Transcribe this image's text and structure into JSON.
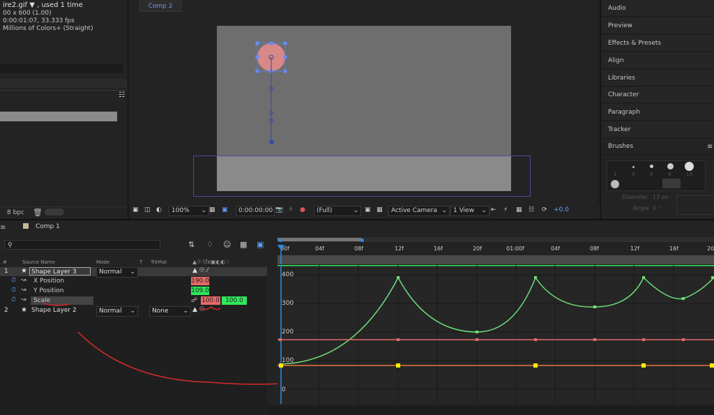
{
  "project": {
    "file_title": "ire2.gif",
    "file_used": ", used 1 time",
    "file_dims": "00 x 600 (1.00)",
    "file_duration": "0:00:01:07, 33.333 fps",
    "file_colors": "Millions of Colors+ (Straight)",
    "bpc": "8 bpc"
  },
  "comp_viewer": {
    "tab_label": "Comp 2",
    "zoom": "100%",
    "timecode": "0:00:00:00",
    "resolution": "(Full)",
    "camera": "Active Camera",
    "views": "1 View",
    "exposure": "+0.0"
  },
  "right_panel": {
    "items": [
      "Audio",
      "Preview",
      "Effects & Presets",
      "Align",
      "Libraries",
      "Character",
      "Paragraph",
      "Tracker",
      "Brushes"
    ],
    "brush_sizes": [
      "1",
      "3",
      "5",
      "9",
      "13"
    ],
    "diameter_label": "Diameter",
    "diameter_value": "13 px",
    "angle_label": "Angle",
    "angle_value": "0 °"
  },
  "timeline": {
    "tab_label": "Comp 1",
    "search_placeholder": "",
    "columns": {
      "num": "#",
      "source": "Source Name",
      "mode": "Mode",
      "t": "T",
      "trkmat": "TrkMat"
    },
    "layers": [
      {
        "num": "1",
        "name": "Shape Layer 3",
        "mode": "Normal"
      },
      {
        "num": "2",
        "name": "Shape Layer 2",
        "mode": "Normal",
        "trkmat": "None"
      }
    ],
    "properties": [
      {
        "name": "X Position",
        "value": "190.0"
      },
      {
        "name": "Y Position",
        "value": "109.0"
      },
      {
        "name": "Scale",
        "value": "100.0",
        "value2": "100.0 %"
      }
    ],
    "ruler_ticks": [
      "00f",
      "04f",
      "08f",
      "12f",
      "16f",
      "20f",
      "01:00f",
      "04f",
      "08f",
      "12f",
      "16f",
      "20"
    ],
    "graph_y_ticks": [
      "400",
      "300",
      "200",
      "100",
      "0"
    ]
  },
  "colors": {
    "accent": "#2d8ceb",
    "curve_green": "#6fe07a",
    "curve_red": "#e46a6a",
    "curve_orange": "#e8743c",
    "keyframe_yellow": "#ffee00",
    "value_red": "#e86a6a",
    "value_green": "#2ee85a"
  }
}
